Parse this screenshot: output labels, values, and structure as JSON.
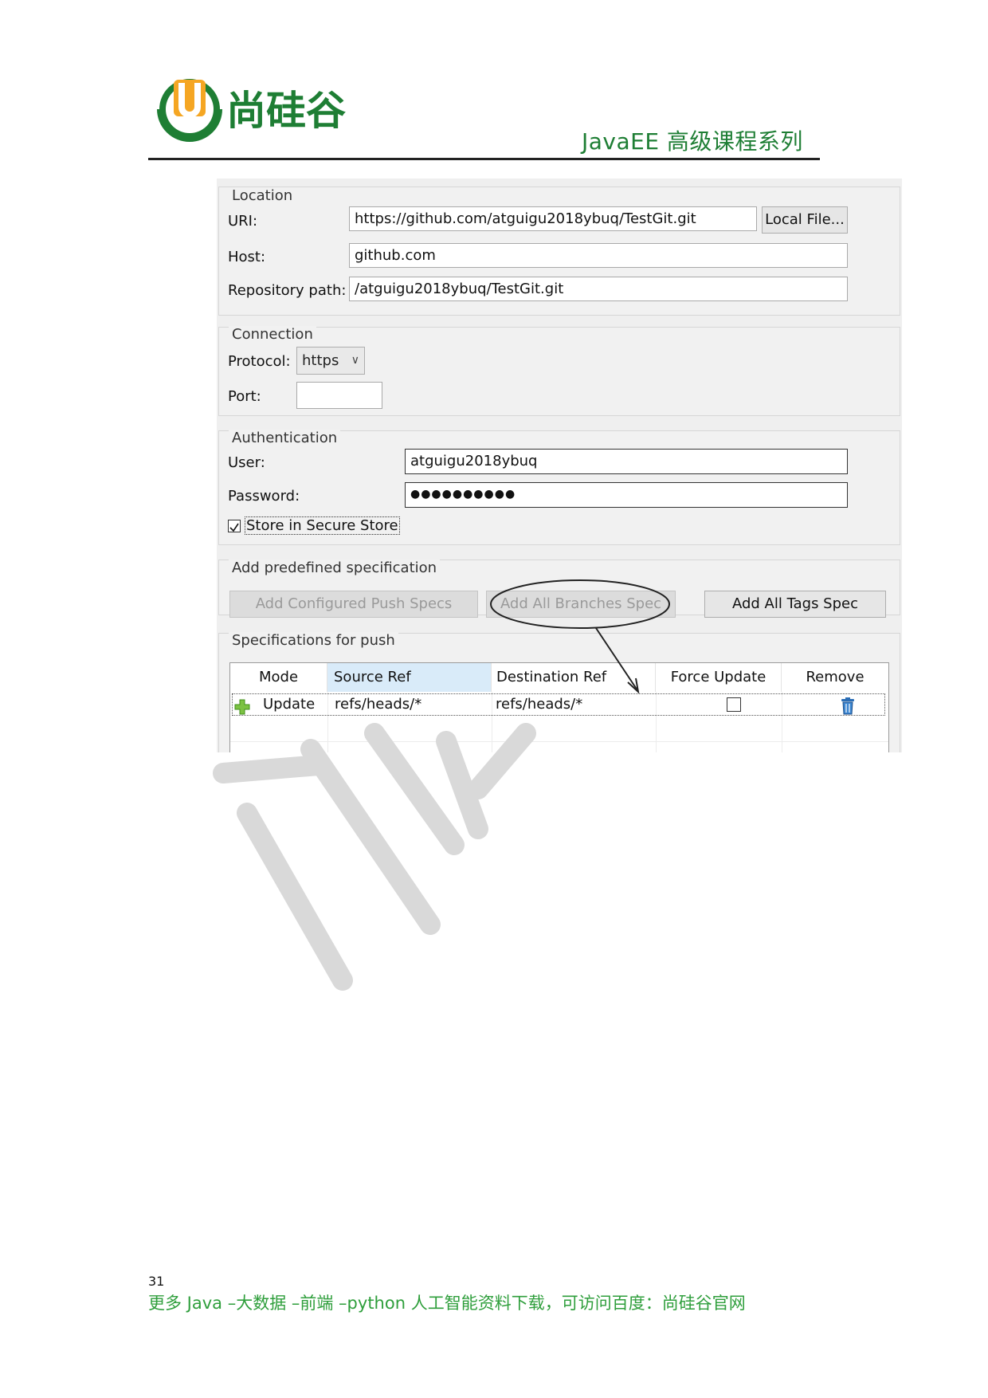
{
  "header": {
    "brand": "尚硅谷",
    "course": "JavaEE 高级课程系列",
    "colors": {
      "green": "#1e7e34",
      "orange": "#f5a623"
    }
  },
  "dialog": {
    "location": {
      "title": "Location",
      "uri_label": "URI:",
      "uri_value": "https://github.com/atguigu2018ybuq/TestGit.git",
      "local_file_button": "Local File...",
      "host_label": "Host:",
      "host_value": "github.com",
      "repo_label": "Repository path:",
      "repo_value": "/atguigu2018ybuq/TestGit.git"
    },
    "connection": {
      "title": "Connection",
      "protocol_label": "Protocol:",
      "protocol_value": "https",
      "port_label": "Port:",
      "port_value": ""
    },
    "authentication": {
      "title": "Authentication",
      "user_label": "User:",
      "user_value": "atguigu2018ybuq",
      "password_label": "Password:",
      "password_value": "●●●●●●●●●●",
      "store_label": "Store in Secure Store",
      "store_checked": true
    },
    "predefined": {
      "title": "Add predefined specification",
      "configured_button": "Add Configured Push Specs",
      "branches_button": "Add All Branches Spec",
      "tags_button": "Add All Tags Spec"
    },
    "specs": {
      "title": "Specifications for push",
      "columns": [
        "Mode",
        "Source Ref",
        "Destination Ref",
        "Force Update",
        "Remove"
      ],
      "rows": [
        {
          "mode": "Update",
          "source": "refs/heads/*",
          "destination": "refs/heads/*",
          "force": false
        }
      ]
    }
  },
  "footer": {
    "page_number": "31",
    "text": "更多 Java –大数据 –前端 –python 人工智能资料下载，可访问百度：尚硅谷官网"
  }
}
